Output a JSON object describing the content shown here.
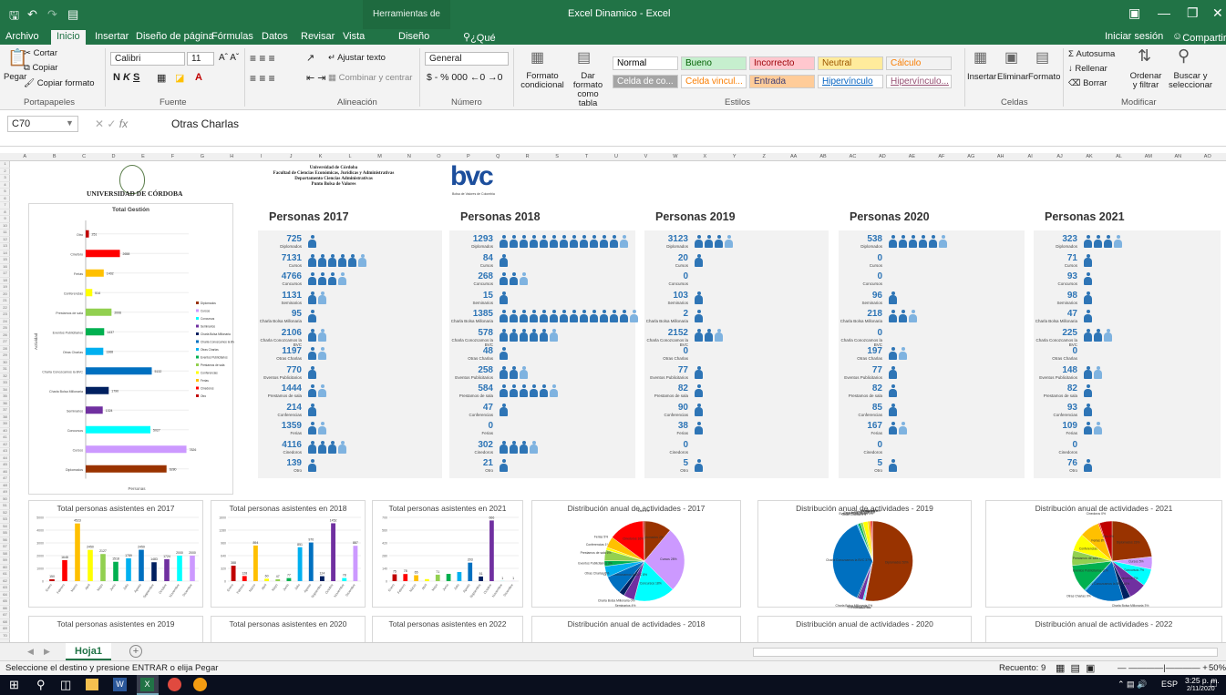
{
  "titlebar": {
    "context": "Herramientas de tabla",
    "document": "Excel Dinamico - Excel"
  },
  "tabs": {
    "archivo": "Archivo",
    "inicio": "Inicio",
    "insertar": "Insertar",
    "diseno_pagina": "Diseño de página",
    "formulas": "Fórmulas",
    "datos": "Datos",
    "revisar": "Revisar",
    "vista": "Vista",
    "diseno": "Diseño",
    "tell": "¿Qué desea hacer?",
    "signin": "Iniciar sesión",
    "share": "Compartir"
  },
  "ribbon": {
    "cortar": "Cortar",
    "copiar": "Copiar",
    "pegar": "Pegar",
    "copiar_formato": "Copiar formato",
    "portapapeles": "Portapapeles",
    "font": "Calibri",
    "size": "11",
    "fuente": "Fuente",
    "ajustar": "Ajustar texto",
    "combinar": "Combinar y centrar",
    "alineacion": "Alineación",
    "numfmt": "General",
    "numero": "Número",
    "formato_cond": "Formato condicional",
    "dar_formato": "Dar formato como tabla",
    "estilos": "Estilos",
    "styles": [
      {
        "label": "Normal",
        "bg": "#ffffff",
        "fg": "#000000"
      },
      {
        "label": "Bueno",
        "bg": "#c6efce",
        "fg": "#006100"
      },
      {
        "label": "Incorrecto",
        "bg": "#ffc7ce",
        "fg": "#9c0006"
      },
      {
        "label": "Neutral",
        "bg": "#ffeb9c",
        "fg": "#9c5700"
      },
      {
        "label": "Cálculo",
        "bg": "#f2f2f2",
        "fg": "#fa7d00"
      },
      {
        "label": "Celda de co...",
        "bg": "#a5a5a5",
        "fg": "#ffffff"
      },
      {
        "label": "Celda vincul...",
        "bg": "#ffffff",
        "fg": "#fa7d00"
      },
      {
        "label": "Entrada",
        "bg": "#ffcc99",
        "fg": "#3f3f76"
      },
      {
        "label": "Hipervínculo",
        "bg": "#ffffff",
        "fg": "#0563c1"
      },
      {
        "label": "Hipervínculo...",
        "bg": "#ffffff",
        "fg": "#954f72"
      }
    ],
    "insertar": "Insertar",
    "eliminar": "Eliminar",
    "formato": "Formato",
    "celdas": "Celdas",
    "autosuma": "Autosuma",
    "rellenar": "Rellenar",
    "borrar": "Borrar",
    "ordenar": "Ordenar y filtrar",
    "buscar": "Buscar y seleccionar",
    "modificar": "Modificar"
  },
  "formula": {
    "namebox": "C70",
    "fx": "fx",
    "text": "Otras Charlas"
  },
  "header": {
    "udc": "UNIVERSIDAD DE CÓRDOBA",
    "lines": [
      "Universidad de Córdoba",
      "Facultad de Ciencias Económicas, Jurídicas y Administrativas",
      "Departamento Ciencias Administrativas",
      "Punto Bolsa de Valores"
    ],
    "bvc": "bvc",
    "bvc_sub": "Bolsa de Valores de Colombia"
  },
  "gestion": {
    "title": "Total Gestión",
    "ylabel": "Actividad",
    "xlabel": "Personas",
    "bars": [
      {
        "label": "Otro",
        "value": 251,
        "color": "#c00000"
      },
      {
        "label": "Cineforo",
        "value": 2658,
        "color": "#ff0000"
      },
      {
        "label": "Ferias",
        "value": 1402,
        "color": "#ffc000"
      },
      {
        "label": "Conferencias",
        "value": 514,
        "color": "#ffff00"
      },
      {
        "label": "Prestamos de sala",
        "value": 2006,
        "color": "#92d050"
      },
      {
        "label": "Eventos Publicitarios",
        "value": 1437,
        "color": "#00b050"
      },
      {
        "label": "Otras Charlas",
        "value": 1368,
        "color": "#00b0f0"
      },
      {
        "label": "Charla Conozcamos la BVC",
        "value": 5132,
        "color": "#0070c0"
      },
      {
        "label": "Charla Bolsa Millonaria",
        "value": 1790,
        "color": "#002060"
      },
      {
        "label": "Seminarios",
        "value": 1324,
        "color": "#7030a0"
      },
      {
        "label": "Concursos",
        "value": 5027,
        "color": "#00ffff"
      },
      {
        "label": "Cursos",
        "value": 7826,
        "color": "#cc99ff"
      },
      {
        "label": "Diplomados",
        "value": 6280,
        "color": "#993300"
      }
    ],
    "legend": [
      "Diplomados",
      "Cursos",
      "Concursos",
      "Seminarios",
      "Charla Bolsa Millonaria",
      "Charla Conozcamos la BVC",
      "Otras Charlas",
      "Eventos Publicitarios",
      "Prestamos de sala",
      "Conferencias",
      "Ferias",
      "Cinedoros",
      "Otro"
    ]
  },
  "personas": [
    {
      "title": "Personas 2017",
      "rows": [
        [
          "725",
          "Diplomados",
          1
        ],
        [
          "7131",
          "Cursos",
          6
        ],
        [
          "4766",
          "Concursos",
          4
        ],
        [
          "1131",
          "Seminarios",
          2
        ],
        [
          "95",
          "Charla Bolsa Millonaria",
          1
        ],
        [
          "2106",
          "Charla Conozcamos la BVC",
          2
        ],
        [
          "1197",
          "Otras Charlas",
          2
        ],
        [
          "770",
          "Eventos Publicitarios",
          1
        ],
        [
          "1444",
          "Prestamos de sala",
          2
        ],
        [
          "214",
          "Conferencias",
          1
        ],
        [
          "1359",
          "Ferias",
          2
        ],
        [
          "4116",
          "Cinedoros",
          4
        ],
        [
          "139",
          "Otro",
          1
        ]
      ]
    },
    {
      "title": "Personas 2018",
      "rows": [
        [
          "1293",
          "Diplomados",
          13
        ],
        [
          "84",
          "Cursos",
          1
        ],
        [
          "268",
          "Concursos",
          3
        ],
        [
          "15",
          "Seminarios",
          1
        ],
        [
          "1385",
          "Charla Bolsa Millonaria",
          14
        ],
        [
          "578",
          "Charla Conozcamos la BVC",
          6
        ],
        [
          "48",
          "Otras Charlas",
          1
        ],
        [
          "258",
          "Eventos Publicitarios",
          3
        ],
        [
          "584",
          "Prestamos de sala",
          6
        ],
        [
          "47",
          "Conferencias",
          1
        ],
        [
          "0",
          "Ferias",
          0
        ],
        [
          "302",
          "Cinedoros",
          4
        ],
        [
          "21",
          "Otro",
          1
        ]
      ]
    },
    {
      "title": "Personas 2019",
      "rows": [
        [
          "3123",
          "Diplomados",
          4
        ],
        [
          "20",
          "Cursos",
          1
        ],
        [
          "0",
          "Concursos",
          0
        ],
        [
          "103",
          "Seminarios",
          1
        ],
        [
          "2",
          "Charla Bolsa Millonaria",
          1
        ],
        [
          "2152",
          "Charla Conozcamos la BVC",
          3
        ],
        [
          "0",
          "Otras Charlas",
          0
        ],
        [
          "77",
          "Eventos Publicitarios",
          1
        ],
        [
          "82",
          "Prestamos de sala",
          1
        ],
        [
          "90",
          "Conferencias",
          1
        ],
        [
          "38",
          "Ferias",
          1
        ],
        [
          "0",
          "Cinedoros",
          0
        ],
        [
          "5",
          "Otro",
          1
        ]
      ]
    },
    {
      "title": "Personas 2020",
      "rows": [
        [
          "538",
          "Diplomados",
          6
        ],
        [
          "0",
          "Cursos",
          0
        ],
        [
          "0",
          "Concursos",
          0
        ],
        [
          "96",
          "Seminarios",
          1
        ],
        [
          "218",
          "Charla Bolsa Millonaria",
          3
        ],
        [
          "0",
          "Charla Conozcamos la BVC",
          0
        ],
        [
          "197",
          "Otras Charlas",
          2
        ],
        [
          "77",
          "Eventos Publicitarios",
          1
        ],
        [
          "82",
          "Prestamos de sala",
          1
        ],
        [
          "85",
          "Conferencias",
          1
        ],
        [
          "167",
          "Ferias",
          2
        ],
        [
          "0",
          "Cinedoros",
          0
        ],
        [
          "5",
          "Otro",
          1
        ]
      ]
    },
    {
      "title": "Personas 2021",
      "rows": [
        [
          "323",
          "Diplomados",
          4
        ],
        [
          "71",
          "Cursos",
          1
        ],
        [
          "93",
          "Concursos",
          1
        ],
        [
          "98",
          "Seminarios",
          1
        ],
        [
          "47",
          "Charla Bolsa Millonaria",
          1
        ],
        [
          "225",
          "Charla Conozcamos la BVC",
          3
        ],
        [
          "0",
          "Otras Charlas",
          0
        ],
        [
          "148",
          "Eventos Publicitarios",
          2
        ],
        [
          "82",
          "Prestamos de sala",
          1
        ],
        [
          "93",
          "Conferencias",
          1
        ],
        [
          "109",
          "Ferias",
          2
        ],
        [
          "0",
          "Cinedoros",
          0
        ],
        [
          "76",
          "Otro",
          1
        ]
      ]
    }
  ],
  "monthly": [
    {
      "title": "Total personas asistentes en 2017",
      "ymax": 5000,
      "values": [
        150,
        1648,
        4523,
        2450,
        2127,
        1518,
        1789,
        2459,
        1483,
        1724,
        2000,
        2000
      ],
      "labels": [
        "150",
        "1648",
        "4523",
        "2450",
        "2127",
        "1518",
        "1789",
        "2459",
        "1483",
        "1724",
        "2000",
        "2000"
      ]
    },
    {
      "title": "Total personas asistentes en 2018",
      "ymax": 1600,
      "values": [
        388,
        128,
        894,
        60,
        47,
        77,
        851,
        970,
        124,
        1452,
        78,
        887
      ],
      "labels": [
        "388",
        "128",
        "894",
        "60",
        "47",
        "77",
        "851",
        "970",
        "124",
        "1452",
        "78",
        "887"
      ]
    },
    {
      "title": "Total personas asistentes en 2021",
      "ymax": 700,
      "values": [
        75,
        78,
        65,
        22,
        71,
        80,
        100,
        203,
        51,
        666,
        1,
        1
      ],
      "labels": [
        "75",
        "78",
        "65",
        "",
        "71",
        "",
        "",
        "203",
        "51",
        "666",
        "1",
        "1"
      ]
    }
  ],
  "months": [
    "Enero",
    "Febrero",
    "Marzo",
    "Abril",
    "Mayo",
    "Junio",
    "Julio",
    "Agosto",
    "Septiembre",
    "Octubre",
    "Noviembre",
    "Diciembre"
  ],
  "pies": [
    {
      "title": "Distribución anual de actividades - 2017",
      "slices": [
        10,
        24,
        15,
        4,
        2,
        7,
        4,
        2,
        4,
        1,
        4,
        13,
        0.5
      ],
      "labels": [
        "Diplomados 2%",
        "Cursos 28%",
        "Concursos 18%",
        "Seminarios 4%",
        "Charla Bolsa Millonaria 0%",
        "Charla Conozcamos la BVC 8%",
        "Otras Charlas 5%",
        "Eventos Publicitarios 3%",
        "Prestamos de sala 6%",
        "Conferencias 1%",
        "Ferias 5%",
        "Cinedoros 16%",
        "Otro 1%"
      ]
    },
    {
      "title": "Distribución anual de actividades - 2019",
      "slices": [
        53,
        0.5,
        0.5,
        2,
        0.5,
        37,
        0.5,
        1,
        1,
        2,
        1,
        0.5,
        0.5
      ],
      "labels": [
        "Diplomados 53%",
        "Cursos 0%",
        "Concursos 0%",
        "Seminarios 2%",
        "Charla Bolsa Millonaria 0%",
        "Charla Conozcamos la BVC 37%",
        "Otras Charlas 0%",
        "Eventos Publicitarios 1%",
        "Prestamos de sala 1%",
        "Conferencias 2%",
        "Ferias 1%",
        "Cinedoros 0%",
        "Otro 0%"
      ]
    },
    {
      "title": "Distribución anual de actividades - 2021",
      "slices": [
        23,
        5,
        7,
        7,
        3,
        16,
        0.5,
        11,
        6,
        7,
        8,
        0.5,
        5
      ],
      "labels": [
        "Diplomados 23%",
        "Cursos 5%",
        "Concursos 7%",
        "Seminarios 7%",
        "Charla Bolsa Millonaria 3%",
        "Charla Conozcamos la BVC 16%",
        "Otras Charlas 0%",
        "Eventos Publicitarios 11%",
        "Prestamos de sala 6%",
        "Conferencias 7%",
        "Ferias 8%",
        "Cinedoros 0%",
        "Otro 5%"
      ]
    }
  ],
  "bottom_titles": [
    "Total personas asistentes en 2019",
    "Total personas asistentes en 2020",
    "Total personas asistentes en 2022",
    "Distribución anual de actividades - 2018",
    "Distribución anual de actividades - 2020",
    "Distribución anual de actividades - 2022"
  ],
  "activity_colors": [
    "#993300",
    "#cc99ff",
    "#00ffff",
    "#7030a0",
    "#002060",
    "#0070c0",
    "#00b0f0",
    "#00b050",
    "#92d050",
    "#ffff00",
    "#ffc000",
    "#ff0000",
    "#c00000"
  ],
  "sheet": {
    "tab": "Hoja1",
    "add": "+"
  },
  "status": {
    "msg": "Seleccione el destino y presione ENTRAR o elija Pegar",
    "count": "Recuento: 9",
    "zoom": "50%"
  },
  "taskbar": {
    "time": "3:25 p. m.",
    "lang": "ESP",
    "date": "2/11/2020"
  }
}
